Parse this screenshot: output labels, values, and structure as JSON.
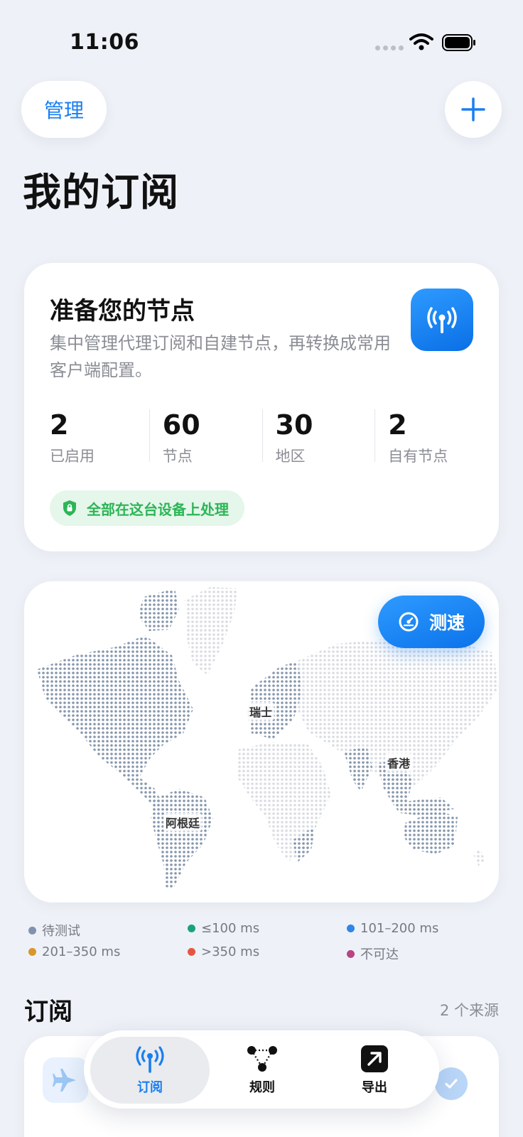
{
  "status": {
    "time": "11:06"
  },
  "header": {
    "manage_label": "管理",
    "title": "我的订阅"
  },
  "hero": {
    "title": "准备您的节点",
    "description": "集中管理代理订阅和自建节点，再转换成常用客户端配置。",
    "stats": [
      {
        "value": "2",
        "label": "已启用"
      },
      {
        "value": "60",
        "label": "节点"
      },
      {
        "value": "30",
        "label": "地区"
      },
      {
        "value": "2",
        "label": "自有节点"
      }
    ],
    "privacy_label": "全部在这台设备上处理",
    "privacy_color": "#2cb557"
  },
  "map": {
    "speed_test_label": "测速",
    "locations": {
      "switzerland": "瑞士",
      "hongkong": "香港",
      "argentina": "阿根廷"
    }
  },
  "legend": [
    {
      "label": "待测试",
      "color": "#7f93ad"
    },
    {
      "label": "≤100 ms",
      "color": "#1aa37a"
    },
    {
      "label": "101–200 ms",
      "color": "#2f86e6"
    },
    {
      "label": "201–350 ms",
      "color": "#d9962a"
    },
    {
      "label": ">350 ms",
      "color": "#e4573f"
    },
    {
      "label": "不可达",
      "color": "#b84484"
    }
  ],
  "subscriptions": {
    "title": "订阅",
    "count_label": "2 个来源"
  },
  "tabs": [
    {
      "label": "订阅",
      "icon": "antenna-icon",
      "active": true
    },
    {
      "label": "规则",
      "icon": "nodes-graph-icon",
      "active": false
    },
    {
      "label": "导出",
      "icon": "export-arrow-icon",
      "active": false
    }
  ],
  "colors": {
    "accent": "#1a7ef0",
    "background": "#eef1f7"
  }
}
